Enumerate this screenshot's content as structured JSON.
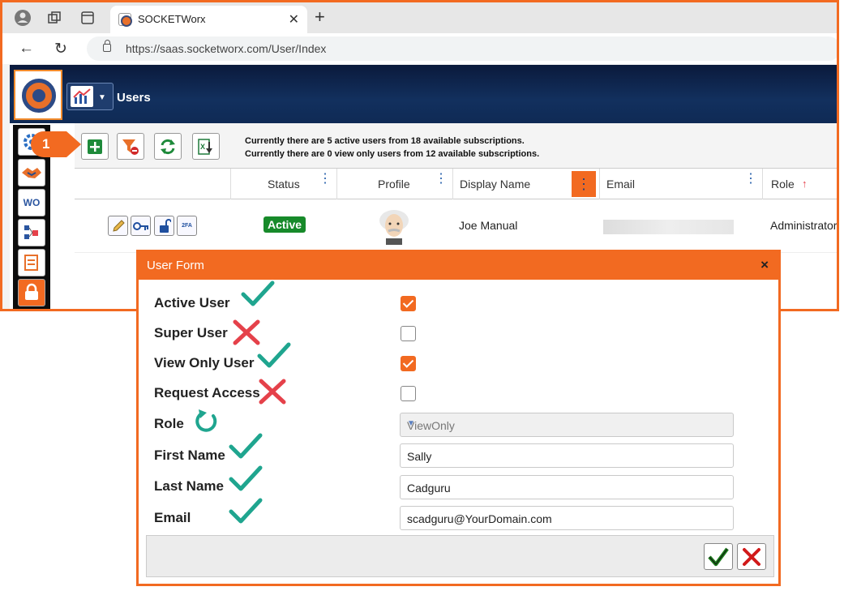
{
  "browser": {
    "tab_title": "SOCKETWorx",
    "url": "https://saas.socketworx.com/User/Index",
    "close_glyph": "✕",
    "newtab_glyph": "+",
    "back_glyph": "←",
    "reload_glyph": "↻"
  },
  "app": {
    "page_title": "Users",
    "sidebar_items": [
      "gear-icon",
      "handshake-icon",
      "WO",
      "org-chart-icon",
      "report-icon",
      "user-lock-icon"
    ],
    "sidebar_wo": "WO"
  },
  "toolbar": {
    "callout_number": "1",
    "info_line1": "Currently there are 5 active users from 18 available subscriptions.",
    "info_line2": "Currently there are 0 view only users from 12 available subscriptions."
  },
  "grid": {
    "columns": [
      "Status",
      "Profile",
      "Display Name",
      "Email",
      "Role"
    ],
    "sort_arrow": "↑",
    "rows": [
      {
        "status": "Active",
        "display_name": "Joe Manual",
        "role": "Administrator"
      }
    ],
    "row_icon_2fa": "2FA"
  },
  "modal": {
    "title": "User Form",
    "close_glyph": "×",
    "labels": {
      "active_user": "Active User",
      "super_user": "Super User",
      "view_only_user": "View Only User",
      "request_access": "Request Access",
      "role": "Role",
      "first_name": "First Name",
      "last_name": "Last Name",
      "email": "Email"
    },
    "values": {
      "active_user": true,
      "super_user": false,
      "view_only_user": true,
      "request_access": false,
      "role": "ViewOnly",
      "first_name": "Sally",
      "last_name": "Cadguru",
      "email": "scadguru@YourDomain.com"
    }
  },
  "colors": {
    "accent": "#f26a21",
    "check_mark": "#1fa58f",
    "cross_mark": "#e5414a",
    "active_green": "#178a2a"
  }
}
